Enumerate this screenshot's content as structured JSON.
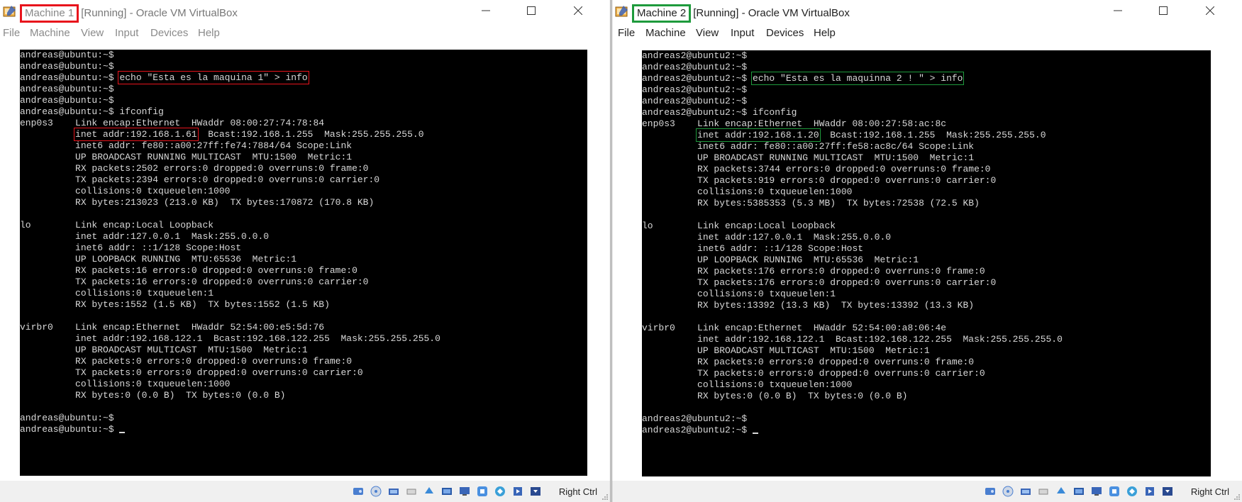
{
  "windows": [
    {
      "vm_name": "Machine 1",
      "title_rest": "[Running] - Oracle VM VirtualBox",
      "menu": [
        "File",
        "Machine",
        "View",
        "Input",
        "Devices",
        "Help"
      ],
      "host_key": "Right Ctrl",
      "terminal_lines": [
        "andreas@ubuntu:~$",
        "andreas@ubuntu:~$",
        "andreas@ubuntu:~$ echo \"Esta es la maquina 1\" > info",
        "andreas@ubuntu:~$",
        "andreas@ubuntu:~$",
        "andreas@ubuntu:~$ ifconfig",
        "enp0s3    Link encap:Ethernet  HWaddr 08:00:27:74:78:84",
        "          inet addr:192.168.1.61  Bcast:192.168.1.255  Mask:255.255.255.0",
        "          inet6 addr: fe80::a00:27ff:fe74:7884/64 Scope:Link",
        "          UP BROADCAST RUNNING MULTICAST  MTU:1500  Metric:1",
        "          RX packets:2502 errors:0 dropped:0 overruns:0 frame:0",
        "          TX packets:2394 errors:0 dropped:0 overruns:0 carrier:0",
        "          collisions:0 txqueuelen:1000",
        "          RX bytes:213023 (213.0 KB)  TX bytes:170872 (170.8 KB)",
        "",
        "lo        Link encap:Local Loopback",
        "          inet addr:127.0.0.1  Mask:255.0.0.0",
        "          inet6 addr: ::1/128 Scope:Host",
        "          UP LOOPBACK RUNNING  MTU:65536  Metric:1",
        "          RX packets:16 errors:0 dropped:0 overruns:0 frame:0",
        "          TX packets:16 errors:0 dropped:0 overruns:0 carrier:0",
        "          collisions:0 txqueuelen:1",
        "          RX bytes:1552 (1.5 KB)  TX bytes:1552 (1.5 KB)",
        "",
        "virbr0    Link encap:Ethernet  HWaddr 52:54:00:e5:5d:76",
        "          inet addr:192.168.122.1  Bcast:192.168.122.255  Mask:255.255.255.0",
        "          UP BROADCAST MULTICAST  MTU:1500  Metric:1",
        "          RX packets:0 errors:0 dropped:0 overruns:0 frame:0",
        "          TX packets:0 errors:0 dropped:0 overruns:0 carrier:0",
        "          collisions:0 txqueuelen:1000",
        "          RX bytes:0 (0.0 B)  TX bytes:0 (0.0 B)",
        "",
        "andreas@ubuntu:~$",
        "andreas@ubuntu:~$ "
      ]
    },
    {
      "vm_name": "Machine 2",
      "title_rest": "[Running] - Oracle VM VirtualBox",
      "menu": [
        "File",
        "Machine",
        "View",
        "Input",
        "Devices",
        "Help"
      ],
      "host_key": "Right Ctrl",
      "terminal_lines": [
        "andreas2@ubuntu2:~$",
        "andreas2@ubuntu2:~$",
        "andreas2@ubuntu2:~$ echo \"Esta es la maquinna 2 ! \" > info",
        "andreas2@ubuntu2:~$",
        "andreas2@ubuntu2:~$",
        "andreas2@ubuntu2:~$ ifconfig",
        "enp0s3    Link encap:Ethernet  HWaddr 08:00:27:58:ac:8c",
        "          inet addr:192.168.1.20  Bcast:192.168.1.255  Mask:255.255.255.0",
        "          inet6 addr: fe80::a00:27ff:fe58:ac8c/64 Scope:Link",
        "          UP BROADCAST RUNNING MULTICAST  MTU:1500  Metric:1",
        "          RX packets:3744 errors:0 dropped:0 overruns:0 frame:0",
        "          TX packets:919 errors:0 dropped:0 overruns:0 carrier:0",
        "          collisions:0 txqueuelen:1000",
        "          RX bytes:5385353 (5.3 MB)  TX bytes:72538 (72.5 KB)",
        "",
        "lo        Link encap:Local Loopback",
        "          inet addr:127.0.0.1  Mask:255.0.0.0",
        "          inet6 addr: ::1/128 Scope:Host",
        "          UP LOOPBACK RUNNING  MTU:65536  Metric:1",
        "          RX packets:176 errors:0 dropped:0 overruns:0 frame:0",
        "          TX packets:176 errors:0 dropped:0 overruns:0 carrier:0",
        "          collisions:0 txqueuelen:1",
        "          RX bytes:13392 (13.3 KB)  TX bytes:13392 (13.3 KB)",
        "",
        "virbr0    Link encap:Ethernet  HWaddr 52:54:00:a8:06:4e",
        "          inet addr:192.168.122.1  Bcast:192.168.122.255  Mask:255.255.255.0",
        "          UP BROADCAST MULTICAST  MTU:1500  Metric:1",
        "          RX packets:0 errors:0 dropped:0 overruns:0 frame:0",
        "          TX packets:0 errors:0 dropped:0 overruns:0 carrier:0",
        "          collisions:0 txqueuelen:1000",
        "          RX bytes:0 (0.0 B)  TX bytes:0 (0.0 B)",
        "",
        "andreas2@ubuntu2:~$",
        "andreas2@ubuntu2:~$ "
      ]
    }
  ],
  "window_controls": [
    "minimize-icon",
    "maximize-icon",
    "close-icon"
  ],
  "status_icons": [
    "hard-disk-icon",
    "optical-drive-icon",
    "audio-icon",
    "network-icon",
    "usb-icon",
    "shared-folders-icon",
    "display-icon",
    "video-capture-icon",
    "cpu-icon",
    "mouse-integration-icon",
    "keyboard-icon"
  ],
  "colors": {
    "machine1_highlight": "#e8141c",
    "machine2_highlight": "#1e9a3c",
    "terminal_bg": "#000000",
    "terminal_fg": "#d8d8d8"
  }
}
